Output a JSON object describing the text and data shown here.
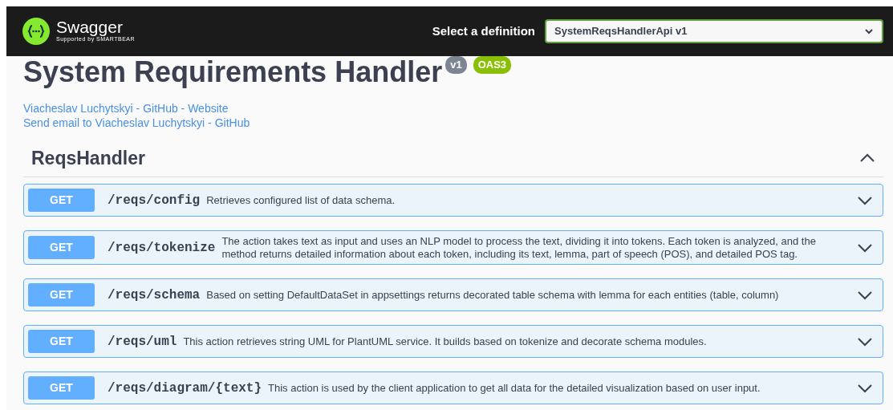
{
  "topbar": {
    "logo_text": "Swagger",
    "logo_subtext": "Supported by SMARTBEAR",
    "definition_label": "Select a definition",
    "definition_value": "SystemReqsHandlerApi v1"
  },
  "info": {
    "title": "System Requirements Handler",
    "version": "v1",
    "spec": "OAS3",
    "links": [
      "Viacheslav Luchytskyi - GitHub - Website",
      "Send email to Viacheslav Luchytskyi - GitHub"
    ]
  },
  "section": {
    "name": "ReqsHandler",
    "expanded": true,
    "operations": [
      {
        "method": "GET",
        "path": "/reqs/config",
        "summary": "Retrieves configured list of data schema.",
        "expanded": false
      },
      {
        "method": "GET",
        "path": "/reqs/tokenize",
        "summary": "The action takes text as input and uses an NLP model to process the text, dividing it into tokens. Each token is analyzed, and the method returns detailed information about each token, including its text, lemma, part of speech (POS), and detailed POS tag.",
        "expanded": false
      },
      {
        "method": "GET",
        "path": "/reqs/schema",
        "summary": "Based on setting DefaultDataSet in appsettings returns decorated table schema with lemma for each entities (table, column)",
        "expanded": false
      },
      {
        "method": "GET",
        "path": "/reqs/uml",
        "summary": "This action retrieves string UML for PlantUML service. It builds based on tokenize and decorate schema modules.",
        "expanded": false
      },
      {
        "method": "GET",
        "path": "/reqs/diagram/{text}",
        "summary": "This action is used by the client application to get all data for the detailed visualization based on user input.",
        "expanded": false
      }
    ]
  }
}
